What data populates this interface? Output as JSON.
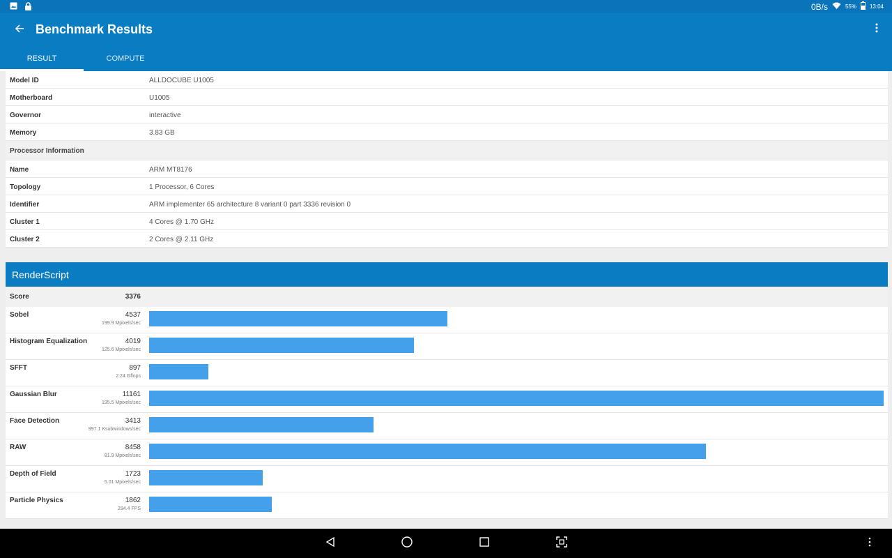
{
  "status_bar": {
    "left_icons": [
      "image-icon",
      "lock-icon"
    ],
    "network_speed": "0B/s",
    "battery": "55%",
    "time": "13:04",
    "icons": [
      "wifi-icon",
      "battery-icon"
    ]
  },
  "app_bar": {
    "title": "Benchmark Results",
    "back_icon": "arrow-back-icon",
    "overflow_icon": "more-vert-icon",
    "color": "#0a7dc2"
  },
  "tabs": [
    {
      "label": "RESULT",
      "active": true
    },
    {
      "label": "COMPUTE",
      "active": false
    }
  ],
  "system_info": [
    {
      "key": "Model ID",
      "value": "ALLDOCUBE U1005"
    },
    {
      "key": "Motherboard",
      "value": "U1005"
    },
    {
      "key": "Governor",
      "value": "interactive"
    },
    {
      "key": "Memory",
      "value": "3.83 GB"
    }
  ],
  "processor_section": {
    "title": "Processor Information",
    "rows": [
      {
        "key": "Name",
        "value": "ARM MT8176"
      },
      {
        "key": "Topology",
        "value": "1 Processor, 6 Cores"
      },
      {
        "key": "Identifier",
        "value": "ARM implementer 65 architecture 8 variant 0 part 3336 revision 0"
      },
      {
        "key": "Cluster 1",
        "value": "4 Cores @ 1.70 GHz"
      },
      {
        "key": "Cluster 2",
        "value": "2 Cores @ 2.11 GHz"
      }
    ]
  },
  "renderscript": {
    "title": "RenderScript",
    "score_label": "Score",
    "score": "3376"
  },
  "chart_data": {
    "type": "bar",
    "categories": [
      "Sobel",
      "Histogram Equalization",
      "SFFT",
      "Gaussian Blur",
      "Face Detection",
      "RAW",
      "Depth of Field",
      "Particle Physics"
    ],
    "values": [
      4537,
      4019,
      897,
      11161,
      3413,
      8458,
      1723,
      1862
    ],
    "units": [
      "199.9 Mpixels/sec",
      "125.6 Mpixels/sec",
      "2.24 Gflops",
      "195.5 Mpixels/sec",
      "997.1 Ksubwindows/sec",
      "81.9 Mpixels/sec",
      "5.01 Mpixels/sec",
      "294.4 FPS"
    ],
    "xlim": [
      0,
      11161
    ],
    "bar_color": "#44a0ea",
    "grid": false
  },
  "nav_bar": {
    "icons": [
      "back-triangle-icon",
      "home-circle-icon",
      "recents-square-icon",
      "screenshot-icon",
      "menu-dots-icon"
    ]
  }
}
